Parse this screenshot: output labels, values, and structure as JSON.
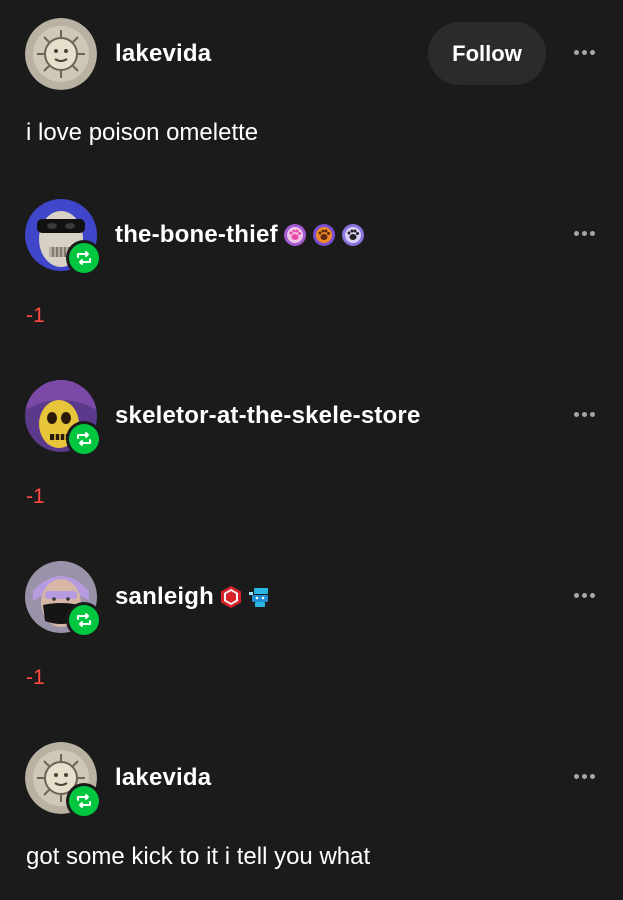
{
  "colors": {
    "background": "#1b1b1c",
    "text": "#ffffff",
    "reblog_green": "#00c73f",
    "negative_red": "#ff4a3d",
    "follow_button_bg": "#2b2b2c"
  },
  "original_post": {
    "username": "lakevida",
    "follow_label": "Follow",
    "body": "i love poison omelette",
    "avatar_icon": "sun-face-coin-icon"
  },
  "reblogs": [
    {
      "username": "the-bone-thief",
      "avatar_icon": "masked-skull-icon",
      "badges": [
        "paw-badge-pink",
        "paw-badge-orange",
        "paw-badge-purple"
      ],
      "body": "-1"
    },
    {
      "username": "skeletor-at-the-skele-store",
      "avatar_icon": "skeletor-icon",
      "badges": [],
      "body": "-1"
    },
    {
      "username": "sanleigh",
      "avatar_icon": "person-with-mask-icon",
      "badges": [
        "hexagon-badge-red",
        "robot-badge-blue"
      ],
      "body": "-1"
    },
    {
      "username": "lakevida",
      "avatar_icon": "sun-face-coin-icon",
      "badges": [],
      "body": "got some kick to it i tell you what"
    }
  ]
}
